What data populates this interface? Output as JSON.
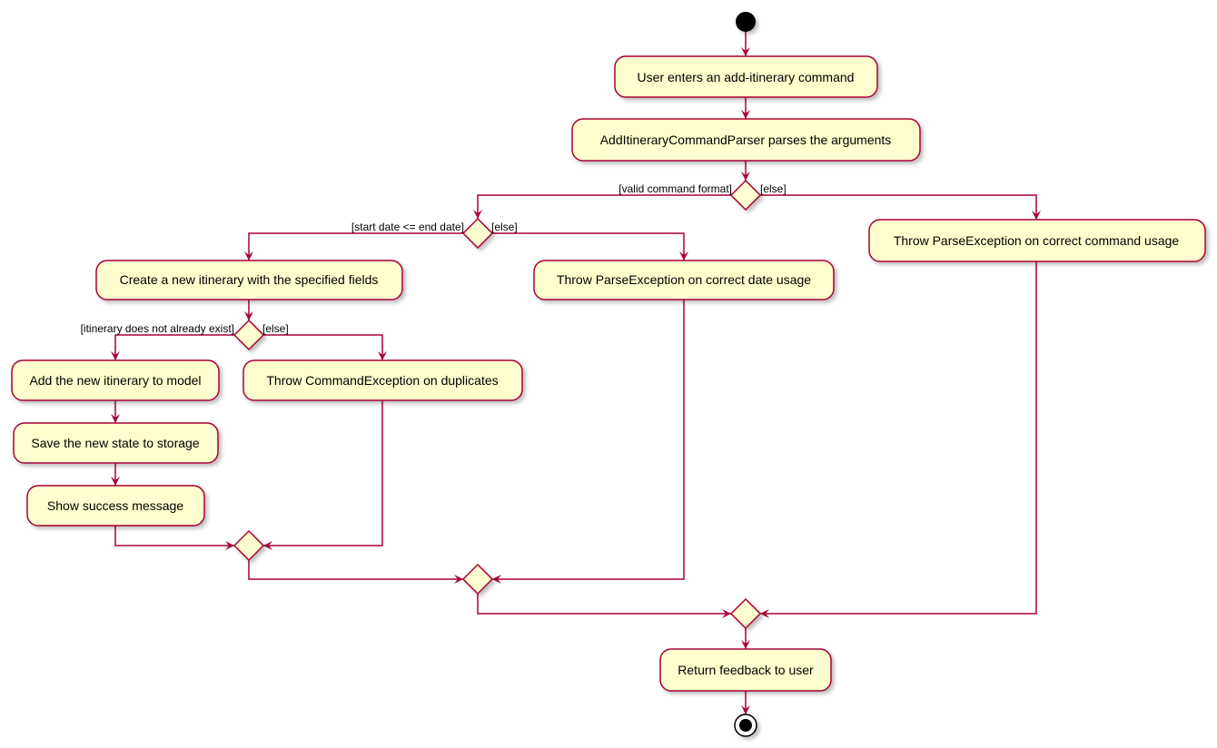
{
  "colors": {
    "fill": "#FEFECE",
    "border": "#A80036",
    "start_end": "#000000"
  },
  "activities": {
    "user_enters": "User enters an add-itinerary command",
    "parser_parses": "AddItineraryCommandParser parses the arguments",
    "throw_command_usage": "Throw ParseException on correct command usage",
    "create_itinerary": "Create a new itinerary with the specified fields",
    "throw_date_usage": "Throw ParseException on correct date usage",
    "add_to_model": "Add the new itinerary to model",
    "throw_duplicates": "Throw CommandException on duplicates",
    "save_state": "Save the new state to storage",
    "show_success": "Show success message",
    "return_feedback": "Return feedback to user"
  },
  "guards": {
    "valid_format": "[valid command format]",
    "else_format": "[else]",
    "date_valid": "[start date <= end date]",
    "else_date": "[else]",
    "not_exist": "[itinerary does not already exist]",
    "else_exist": "[else]"
  }
}
